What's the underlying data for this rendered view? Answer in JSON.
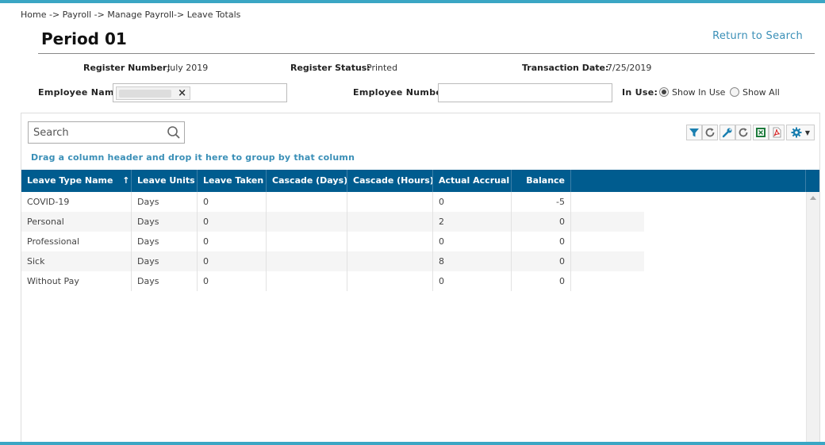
{
  "breadcrumb": "Home -> Payroll -> Manage Payroll-> Leave Totals",
  "page_title": "Period 01",
  "return_link": "Return to Search",
  "register": {
    "number_label": "Register Number:",
    "number_value": "July 2019",
    "status_label": "Register Status:",
    "status_value": "Printed",
    "date_label": "Transaction Date:",
    "date_value": "7/25/2019"
  },
  "filters": {
    "employee_name_label": "Employee Name",
    "employee_number_label": "Employee Number",
    "employee_number_value": "",
    "in_use_label": "In Use:",
    "show_in_use_label": "Show In Use",
    "show_all_label": "Show All",
    "selected": "show_in_use"
  },
  "grid": {
    "search_placeholder": "Search",
    "group_hint": "Drag a column header and drop it here to group by that column",
    "columns": [
      "Leave Type Name",
      "Leave Units",
      "Leave Taken",
      "Cascade (Days)",
      "Cascade (Hours)",
      "Actual Accrual",
      "Balance"
    ],
    "sort_indicator": "↑",
    "rows": [
      [
        "COVID-19",
        "Days",
        "0",
        "",
        "",
        "0",
        "-5"
      ],
      [
        "Personal",
        "Days",
        "0",
        "",
        "",
        "2",
        "0"
      ],
      [
        "Professional",
        "Days",
        "0",
        "",
        "",
        "0",
        "0"
      ],
      [
        "Sick",
        "Days",
        "0",
        "",
        "",
        "8",
        "0"
      ],
      [
        "Without Pay",
        "Days",
        "0",
        "",
        "",
        "0",
        "0"
      ]
    ]
  },
  "icons": {
    "filter": "filter-icon",
    "refresh": "refresh-icon",
    "wrench": "wrench-icon",
    "excel": "excel-icon",
    "pdf": "pdf-icon",
    "settings": "gear-icon"
  },
  "colors": {
    "accent_bar": "#3aa6c4",
    "header_bg": "#005c8f",
    "link": "#3a8fb7"
  }
}
